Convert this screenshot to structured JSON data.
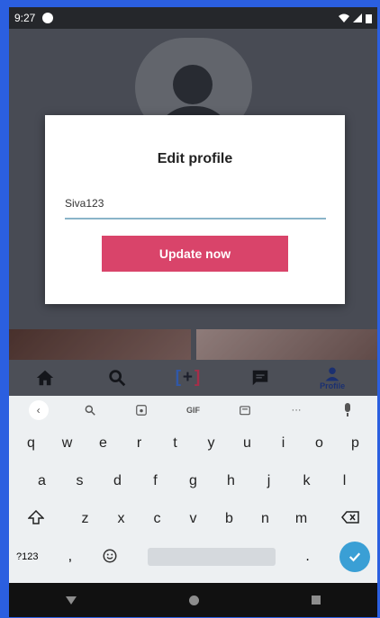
{
  "status": {
    "time": "9:27"
  },
  "dialog": {
    "title": "Edit profile",
    "name_value": "Siva123",
    "button_label": "Update now"
  },
  "appnav": {
    "items": [
      {
        "icon": "home-icon"
      },
      {
        "icon": "search-icon"
      },
      {
        "icon": "add-post-icon"
      },
      {
        "icon": "message-icon"
      },
      {
        "icon": "profile-icon",
        "label": "Profile"
      }
    ]
  },
  "keyboard": {
    "toolbar": {
      "gif": "GIF",
      "more": "···"
    },
    "row1": [
      "q",
      "w",
      "e",
      "r",
      "t",
      "y",
      "u",
      "i",
      "o",
      "p"
    ],
    "row2": [
      "a",
      "s",
      "d",
      "f",
      "g",
      "h",
      "j",
      "k",
      "l"
    ],
    "row3": [
      "z",
      "x",
      "c",
      "v",
      "b",
      "n",
      "m"
    ],
    "symbols": "?123",
    "comma": ",",
    "period": "."
  },
  "colors": {
    "accent": "#d9446a",
    "enter": "#3a9fd5"
  }
}
